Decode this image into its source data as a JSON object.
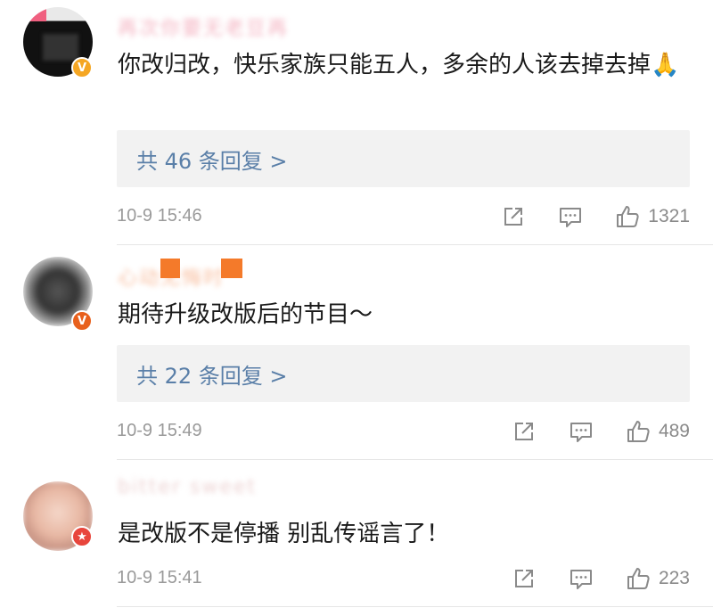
{
  "comments": [
    {
      "username": "再次你要无老豆再",
      "text": "你改归改，快乐家族只能五人，多余的人该去掉去掉🙏",
      "replies_label": "共 46 条回复 >",
      "time": "10-9 15:46",
      "likes": "1321",
      "badge": {
        "icon": "verified-v-icon",
        "color": "#f5a623"
      }
    },
    {
      "username": "心动无悔时",
      "text": "期待升级改版后的节目～",
      "replies_label": "共 22 条回复 >",
      "time": "10-9 15:49",
      "likes": "489",
      "badge": {
        "icon": "verified-v-icon",
        "color": "#e8601c"
      }
    },
    {
      "username": "bitter sweet",
      "text": "是改版不是停播 别乱传谣言了！",
      "time": "10-9 15:41",
      "likes": "223",
      "badge": {
        "icon": "star-badge-icon",
        "color": "#e8453c"
      }
    }
  ]
}
